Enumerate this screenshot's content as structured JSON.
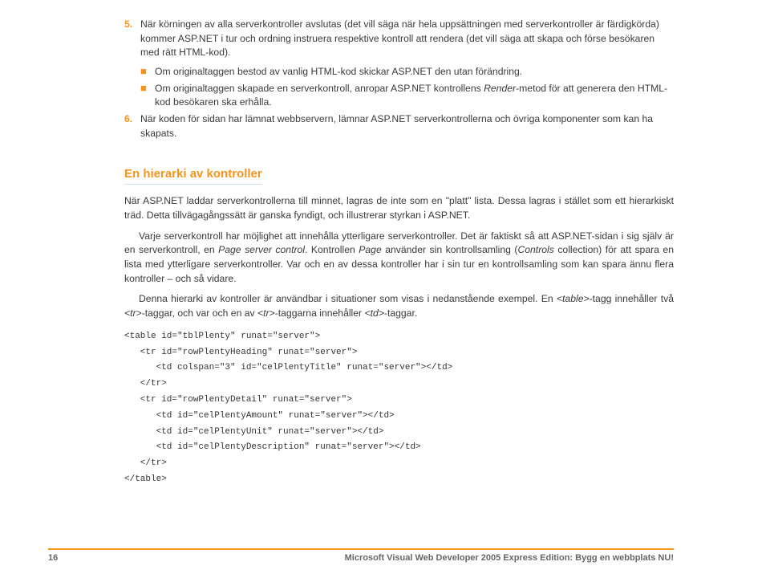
{
  "list": {
    "item5": {
      "num": "5.",
      "text": "När körningen av alla serverkontroller avslutas (det vill säga när hela uppsättningen med serverkontroller är färdigkörda) kommer ASP.NET i tur och ordning instruera respektive kontroll att rendera (det vill säga att skapa och förse besökaren med rätt HTML-kod)."
    },
    "bullet1": "Om originaltaggen bestod av vanlig HTML-kod skickar ASP.NET den utan förändring.",
    "bullet2_a": "Om originaltaggen skapade en serverkontroll, anropar ASP.NET kontrollens ",
    "bullet2_i": "Render",
    "bullet2_b": "-metod för att generera den HTML-kod besökaren ska erhålla.",
    "item6": {
      "num": "6.",
      "text": "När koden för sidan har lämnat webbservern, lämnar ASP.NET serverkontrollerna och övriga komponenter som kan ha skapats."
    }
  },
  "heading": "En hierarki av kontroller",
  "p1": "När ASP.NET laddar serverkontrollerna till minnet, lagras de inte som en \"platt\" lista. Dessa lagras i stället som ett hierarkiskt träd. Detta tillvägagångssätt är ganska fyndigt, och illustrerar styrkan i ASP.NET.",
  "p2_a": "Varje serverkontroll har möjlighet att innehålla ytterligare serverkontroller. Det är faktiskt så att ASP.NET-sidan i sig själv är en serverkontroll, en ",
  "p2_i": "Page server control",
  "p2_b": ". Kontrollen ",
  "p2_i2": "Page",
  "p2_c": " använder sin kontrollsamling (",
  "p2_i3": "Controls",
  "p2_d": " collection) för att spara en lista med ytterligare serverkontroller. Var och en av dessa kontroller har i sin tur en kontrollsamling som kan spara ännu flera kontroller – och så vidare.",
  "p3_a": "Denna hierarki av kontroller är användbar i situationer som visas i nedanstående exempel. En ",
  "p3_i1": "<table>",
  "p3_b": "-tagg innehåller två ",
  "p3_i2": "<tr>",
  "p3_c": "-taggar, och var och en av ",
  "p3_i3": "<tr>",
  "p3_d": "-taggarna innehåller ",
  "p3_i4": "<td>",
  "p3_e": "-taggar.",
  "code": "<table id=\"tblPlenty\" runat=\"server\">\n   <tr id=\"rowPlentyHeading\" runat=\"server\">\n      <td colspan=\"3\" id=\"celPlentyTitle\" runat=\"server\"></td>\n   </tr>\n   <tr id=\"rowPlentyDetail\" runat=\"server\">\n      <td id=\"celPlentyAmount\" runat=\"server\"></td>\n      <td id=\"celPlentyUnit\" runat=\"server\"></td>\n      <td id=\"celPlentyDescription\" runat=\"server\"></td>\n   </tr>\n</table>",
  "footer": {
    "page": "16",
    "title": "Microsoft Visual Web Developer 2005 Express Edition: Bygg en webbplats NU!"
  }
}
